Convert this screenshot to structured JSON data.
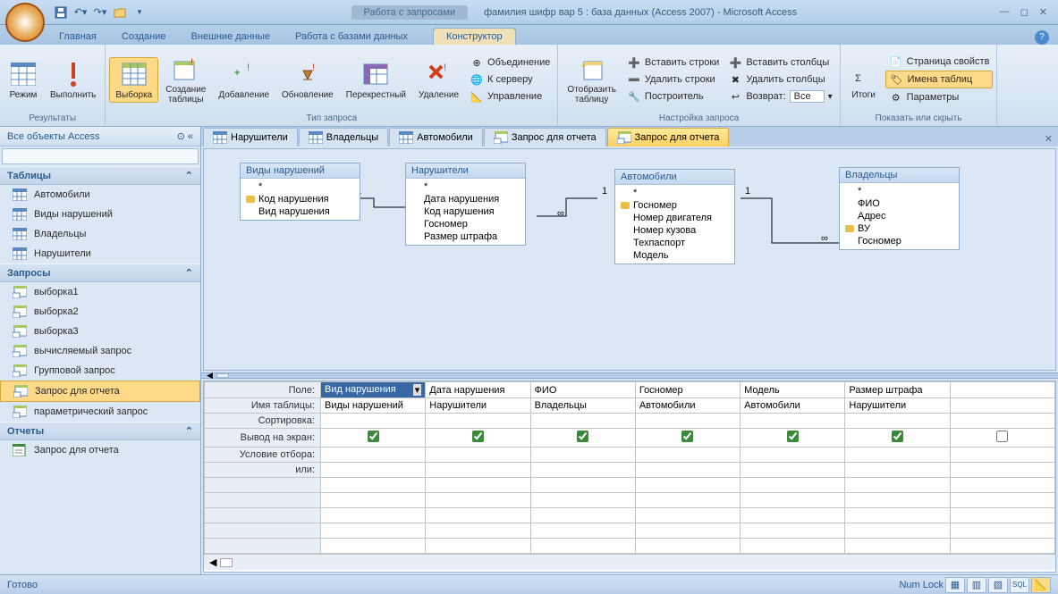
{
  "app": {
    "contextTitle": "Работа с запросами",
    "title": "фамилия шифр вар 5 : база данных (Access 2007) - Microsoft Access"
  },
  "ribbonTabs": {
    "home": "Главная",
    "create": "Создание",
    "external": "Внешние данные",
    "dbtools": "Работа с базами данных",
    "designer": "Конструктор"
  },
  "ribbon": {
    "results": {
      "label": "Результаты",
      "view": "Режим",
      "run": "Выполнить"
    },
    "queryType": {
      "label": "Тип запроса",
      "select": "Выборка",
      "makeTable": "Создание\nтаблицы",
      "append": "Добавление",
      "update": "Обновление",
      "crosstab": "Перекрестный",
      "delete": "Удаление"
    },
    "union": "Объединение",
    "server": "К серверу",
    "control": "Управление",
    "showTable": {
      "label": "Отобразить\nтаблицу"
    },
    "setup": {
      "label": "Настройка запроса",
      "insertRows": "Вставить строки",
      "deleteRows": "Удалить строки",
      "builder": "Построитель",
      "insertCols": "Вставить столбцы",
      "deleteCols": "Удалить столбцы",
      "return": "Возврат:",
      "returnVal": "Все"
    },
    "totals": "Итоги",
    "showHide": {
      "label": "Показать или скрыть",
      "propSheet": "Страница свойств",
      "tableNames": "Имена таблиц",
      "params": "Параметры"
    }
  },
  "nav": {
    "header": "Все объекты Access",
    "sections": {
      "tables": "Таблицы",
      "queries": "Запросы",
      "reports": "Отчеты"
    },
    "tables": [
      "Автомобили",
      "Виды нарушений",
      "Владельцы",
      "Нарушители"
    ],
    "queries": [
      "выборка1",
      "выборка2",
      "выборка3",
      "вычисляемый запрос",
      "Групповой запрос",
      "Запрос для отчета",
      "параметрический запрос"
    ],
    "reports": [
      "Запрос для отчета"
    ]
  },
  "docTabs": [
    "Нарушители",
    "Владельцы",
    "Автомобили",
    "Запрос для отчета",
    "Запрос для отчета"
  ],
  "diagram": {
    "t0": {
      "title": "Виды нарушений",
      "f0": "*",
      "f1": "Код нарушения",
      "f2": "Вид нарушения"
    },
    "t1": {
      "title": "Нарушители",
      "f0": "*",
      "f1": "Дата нарушения",
      "f2": "Код нарушения",
      "f3": "Госномер",
      "f4": "Размер штрафа"
    },
    "t2": {
      "title": "Автомобили",
      "f0": "*",
      "f1": "Госномер",
      "f2": "Номер двигателя",
      "f3": "Номер кузова",
      "f4": "Техпаспорт",
      "f5": "Модель"
    },
    "t3": {
      "title": "Владельцы",
      "f0": "*",
      "f1": "ФИО",
      "f2": "Адрес",
      "f3": "ВУ",
      "f4": "Госномер"
    }
  },
  "qbe": {
    "rows": {
      "field": "Поле:",
      "table": "Имя таблицы:",
      "sort": "Сортировка:",
      "show": "Вывод на экран:",
      "criteria": "Условие отбора:",
      "or": "или:"
    },
    "cols": [
      {
        "field": "Вид нарушения",
        "table": "Виды нарушений",
        "show": true
      },
      {
        "field": "Дата нарушения",
        "table": "Нарушители",
        "show": true
      },
      {
        "field": "ФИО",
        "table": "Владельцы",
        "show": true
      },
      {
        "field": "Госномер",
        "table": "Автомобили",
        "show": true
      },
      {
        "field": "Модель",
        "table": "Автомобили",
        "show": true
      },
      {
        "field": "Размер штрафа",
        "table": "Нарушители",
        "show": true
      },
      {
        "field": "",
        "table": "",
        "show": false
      }
    ]
  },
  "status": {
    "ready": "Готово",
    "numlock": "Num Lock"
  }
}
